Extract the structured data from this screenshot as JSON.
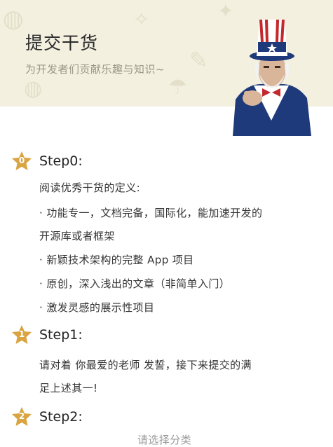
{
  "header": {
    "title": "提交干货",
    "subtitle": "为开发者们贡献乐趣与知识~"
  },
  "steps": [
    {
      "num": "0",
      "title": "Step0:",
      "lines": [
        "阅读优秀干货的定义:",
        "· 功能专一，文档完备，国际化，能加速开发的",
        "开源库或者框架",
        "· 新颖技术架构的完整 App 项目",
        "· 原创，深入浅出的文章（非简单入门）",
        "· 激发灵感的展示性项目"
      ]
    },
    {
      "num": "1",
      "title": "Step1:",
      "lines": [
        "请对着 你最爱的老师 发誓，接下来提交的满",
        "足上述其一!"
      ]
    },
    {
      "num": "2",
      "title": "Step2:",
      "lines": [
        "请选择分类"
      ]
    }
  ],
  "colors": {
    "header_bg": "#f3f0e0",
    "star": "#d9a441",
    "subtitle": "#9b9788"
  },
  "icons": {
    "step_badge": "star-icon",
    "header_image": "uncle-sam-illustration"
  }
}
